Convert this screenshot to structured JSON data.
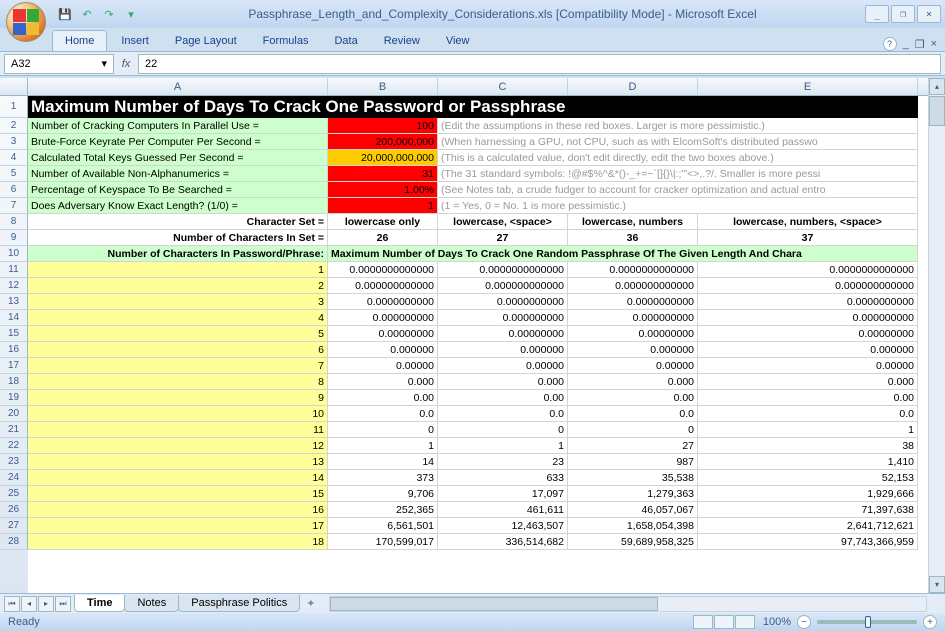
{
  "app": {
    "title": "Passphrase_Length_and_Complexity_Considerations.xls  [Compatibility Mode] - Microsoft Excel"
  },
  "ribbon": {
    "tabs": [
      "Home",
      "Insert",
      "Page Layout",
      "Formulas",
      "Data",
      "Review",
      "View"
    ],
    "active": 0
  },
  "formula_bar": {
    "name_box": "A32",
    "fx_label": "fx",
    "value": "22"
  },
  "columns": [
    "A",
    "B",
    "C",
    "D",
    "E"
  ],
  "row_numbers": [
    1,
    2,
    3,
    4,
    5,
    6,
    7,
    8,
    9,
    10,
    11,
    12,
    13,
    14,
    15,
    16,
    17,
    18,
    19,
    20,
    21,
    22,
    23,
    24,
    25,
    26,
    27,
    28
  ],
  "title_row": "Maximum Number of Days To Crack One Password or Passphrase",
  "params": [
    {
      "label": "Number of Cracking Computers In Parallel Use =",
      "value": "100",
      "style": "red",
      "note": "(Edit the assumptions in these red boxes.  Larger is more pessimistic.)"
    },
    {
      "label": "Brute-Force Keyrate Per Computer Per Second =",
      "value": "200,000,000",
      "style": "red",
      "note": "(When harnessing a GPU, not CPU, such as with ElcomSoft's distributed passwo"
    },
    {
      "label": "Calculated Total Keys Guessed Per Second =",
      "value": "20,000,000,000",
      "style": "orange",
      "note": "(This is a calculated value, don't edit directly, edit the two boxes above.)"
    },
    {
      "label": "Number of Available Non-Alphanumerics =",
      "value": "31",
      "style": "red",
      "note": "(The 31 standard symbols: !@#$%^&*()-_+=~`[]{}\\|:;\"'<>,.?/.  Smaller is more pessi"
    },
    {
      "label": "Percentage of Keyspace To Be Searched =",
      "value": "1.00%",
      "style": "red",
      "note": "(See Notes tab, a crude fudger to account for cracker optimization and actual entro"
    },
    {
      "label": "Does Adversary Know Exact Length? (1/0) =",
      "value": "1",
      "style": "red",
      "note": "(1 = Yes, 0 = No.  1 is more pessimistic.)"
    }
  ],
  "charset_header": {
    "a": "Character Set =",
    "b": "lowercase only",
    "c": "lowercase, <space>",
    "d": "lowercase, numbers",
    "e": "lowercase, numbers, <space>"
  },
  "count_header": {
    "a": "Number of Characters In Set =",
    "b": "26",
    "c": "27",
    "d": "36",
    "e": "37"
  },
  "banner": {
    "a": "Number of Characters In Password/Phrase:",
    "rest": "Maximum Number of Days To Crack One Random Passphrase Of The Given Length And Chara"
  },
  "data_rows": [
    {
      "n": "1",
      "b": "0.0000000000000",
      "c": "0.0000000000000",
      "d": "0.0000000000000",
      "e": "0.0000000000000"
    },
    {
      "n": "2",
      "b": "0.000000000000",
      "c": "0.000000000000",
      "d": "0.000000000000",
      "e": "0.000000000000"
    },
    {
      "n": "3",
      "b": "0.0000000000",
      "c": "0.0000000000",
      "d": "0.0000000000",
      "e": "0.0000000000"
    },
    {
      "n": "4",
      "b": "0.000000000",
      "c": "0.000000000",
      "d": "0.000000000",
      "e": "0.000000000"
    },
    {
      "n": "5",
      "b": "0.00000000",
      "c": "0.00000000",
      "d": "0.00000000",
      "e": "0.00000000"
    },
    {
      "n": "6",
      "b": "0.000000",
      "c": "0.000000",
      "d": "0.000000",
      "e": "0.000000"
    },
    {
      "n": "7",
      "b": "0.00000",
      "c": "0.00000",
      "d": "0.00000",
      "e": "0.00000"
    },
    {
      "n": "8",
      "b": "0.000",
      "c": "0.000",
      "d": "0.000",
      "e": "0.000"
    },
    {
      "n": "9",
      "b": "0.00",
      "c": "0.00",
      "d": "0.00",
      "e": "0.00"
    },
    {
      "n": "10",
      "b": "0.0",
      "c": "0.0",
      "d": "0.0",
      "e": "0.0"
    },
    {
      "n": "11",
      "b": "0",
      "c": "0",
      "d": "0",
      "e": "1"
    },
    {
      "n": "12",
      "b": "1",
      "c": "1",
      "d": "27",
      "e": "38"
    },
    {
      "n": "13",
      "b": "14",
      "c": "23",
      "d": "987",
      "e": "1,410"
    },
    {
      "n": "14",
      "b": "373",
      "c": "633",
      "d": "35,538",
      "e": "52,153"
    },
    {
      "n": "15",
      "b": "9,706",
      "c": "17,097",
      "d": "1,279,363",
      "e": "1,929,666"
    },
    {
      "n": "16",
      "b": "252,365",
      "c": "461,611",
      "d": "46,057,067",
      "e": "71,397,638"
    },
    {
      "n": "17",
      "b": "6,561,501",
      "c": "12,463,507",
      "d": "1,658,054,398",
      "e": "2,641,712,621"
    },
    {
      "n": "18",
      "b": "170,599,017",
      "c": "336,514,682",
      "d": "59,689,958,325",
      "e": "97,743,366,959"
    }
  ],
  "sheet_tabs": {
    "items": [
      "Time",
      "Notes",
      "Passphrase Politics"
    ],
    "active": 0
  },
  "status": {
    "ready": "Ready",
    "zoom": "100%"
  },
  "chart_data": {
    "type": "table",
    "title": "Maximum Number of Days To Crack One Password or Passphrase",
    "parameters": {
      "cracking_computers_parallel": 100,
      "brute_force_keyrate_per_computer_per_second": 200000000,
      "calculated_total_keys_per_second": 20000000000,
      "available_non_alphanumerics": 31,
      "percentage_keyspace_searched": 0.01,
      "adversary_knows_exact_length": 1
    },
    "character_sets": [
      {
        "name": "lowercase only",
        "size": 26
      },
      {
        "name": "lowercase, <space>",
        "size": 27
      },
      {
        "name": "lowercase, numbers",
        "size": 36
      },
      {
        "name": "lowercase, numbers, <space>",
        "size": 37
      }
    ],
    "rows_label": "Number of Characters In Password/Phrase",
    "values_label": "Maximum Number of Days To Crack One Random Passphrase Of The Given Length And Character Set",
    "lengths": [
      1,
      2,
      3,
      4,
      5,
      6,
      7,
      8,
      9,
      10,
      11,
      12,
      13,
      14,
      15,
      16,
      17,
      18
    ],
    "days": {
      "lowercase only": [
        0,
        0,
        0,
        0,
        0,
        0,
        0,
        0,
        0,
        0,
        0,
        1,
        14,
        373,
        9706,
        252365,
        6561501,
        170599017
      ],
      "lowercase, <space>": [
        0,
        0,
        0,
        0,
        0,
        0,
        0,
        0,
        0,
        0,
        0,
        1,
        23,
        633,
        17097,
        461611,
        12463507,
        336514682
      ],
      "lowercase, numbers": [
        0,
        0,
        0,
        0,
        0,
        0,
        0,
        0,
        0,
        0,
        0,
        27,
        987,
        35538,
        1279363,
        46057067,
        1658054398,
        59689958325
      ],
      "lowercase, numbers, <space>": [
        0,
        0,
        0,
        0,
        0,
        0,
        0,
        0,
        0,
        0,
        1,
        38,
        1410,
        52153,
        1929666,
        71397638,
        2641712621,
        97743366959
      ]
    }
  }
}
